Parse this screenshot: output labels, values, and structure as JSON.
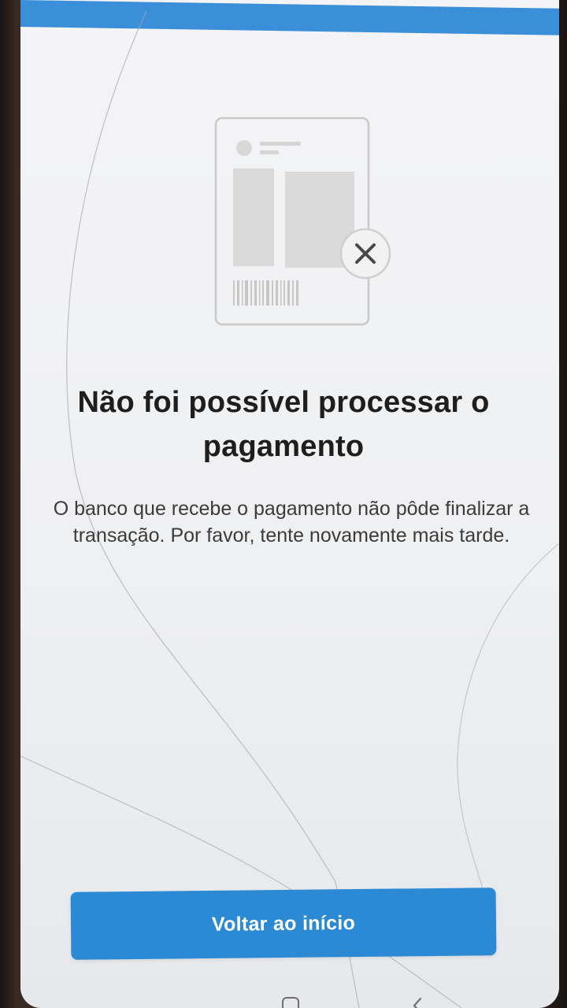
{
  "error": {
    "title": "Não foi possível processar o pagamento",
    "description": "O banco que recebe o pagamento não pôde finalizar a transação. Por favor, tente novamente mais tarde."
  },
  "actions": {
    "back_home_label": "Voltar ao início"
  },
  "icons": {
    "illustration": "payment-slip-error-icon",
    "close": "close-icon"
  },
  "colors": {
    "accent": "#2c8ad4",
    "status_bar": "#3a8fd8",
    "background": "#f1f2f4",
    "title_text": "#1e1e1e",
    "body_text": "#3b3b3b",
    "illustration_line": "#c9c9c9"
  }
}
